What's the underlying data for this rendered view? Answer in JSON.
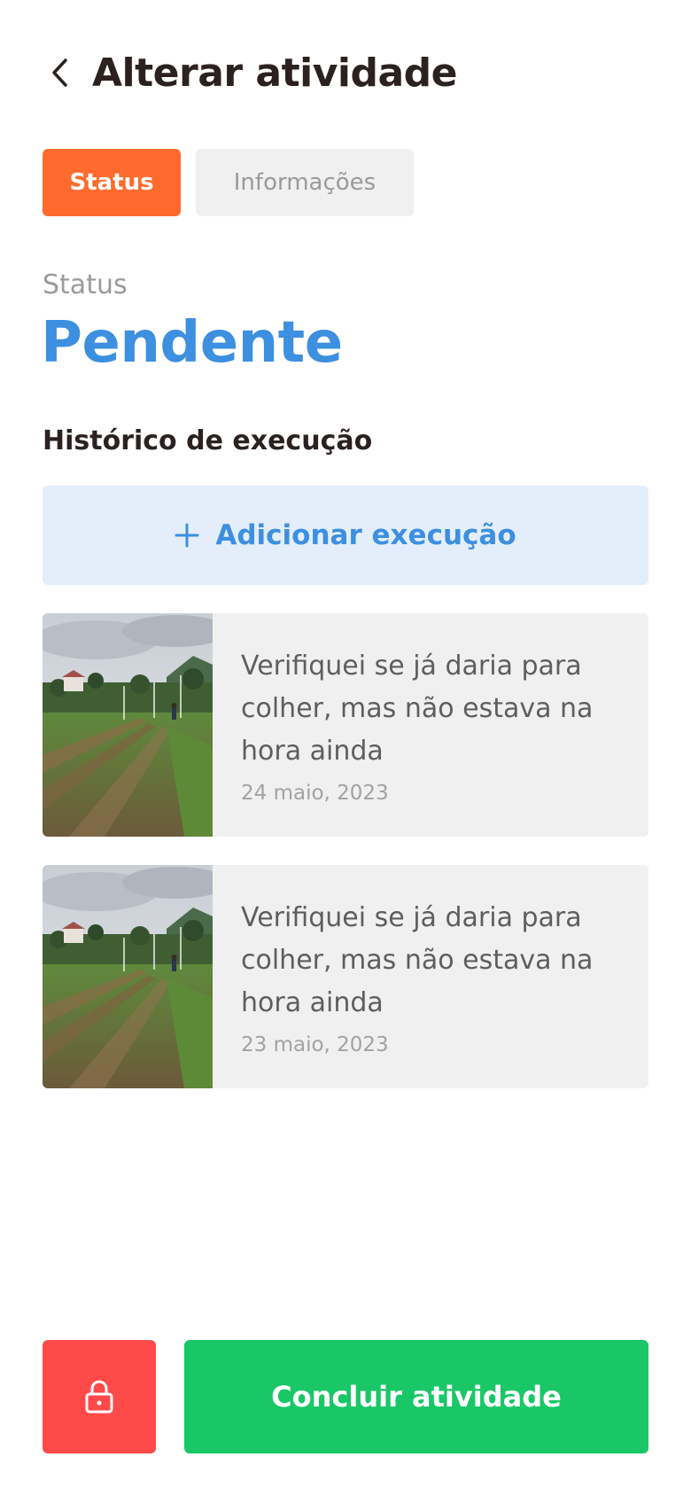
{
  "header": {
    "title": "Alterar atividade",
    "back_icon": "chevron-left-icon"
  },
  "tabs": [
    {
      "label": "Status",
      "active": true
    },
    {
      "label": "Informações",
      "active": false
    }
  ],
  "status": {
    "label": "Status",
    "value": "Pendente"
  },
  "history": {
    "title": "Histórico de execução",
    "add_label": "Adicionar execução",
    "add_icon": "plus-icon",
    "items": [
      {
        "description": "Verifiquei se já daria para colher, mas não estava na hora ainda",
        "date": "24 maio, 2023",
        "photo": "field-photo"
      },
      {
        "description": "Verifiquei se já daria para colher, mas não estava na hora ainda",
        "date": "23 maio, 2023",
        "photo": "field-photo"
      }
    ]
  },
  "footer": {
    "lock_icon": "lock-icon",
    "complete_label": "Concluir atividade"
  },
  "colors": {
    "accent_orange": "#ff6b2c",
    "status_blue": "#3d8fe0",
    "add_bg": "#e3eefa",
    "danger_red": "#ff4a4a",
    "success_green": "#19c766",
    "card_bg": "#f0f0f0"
  }
}
